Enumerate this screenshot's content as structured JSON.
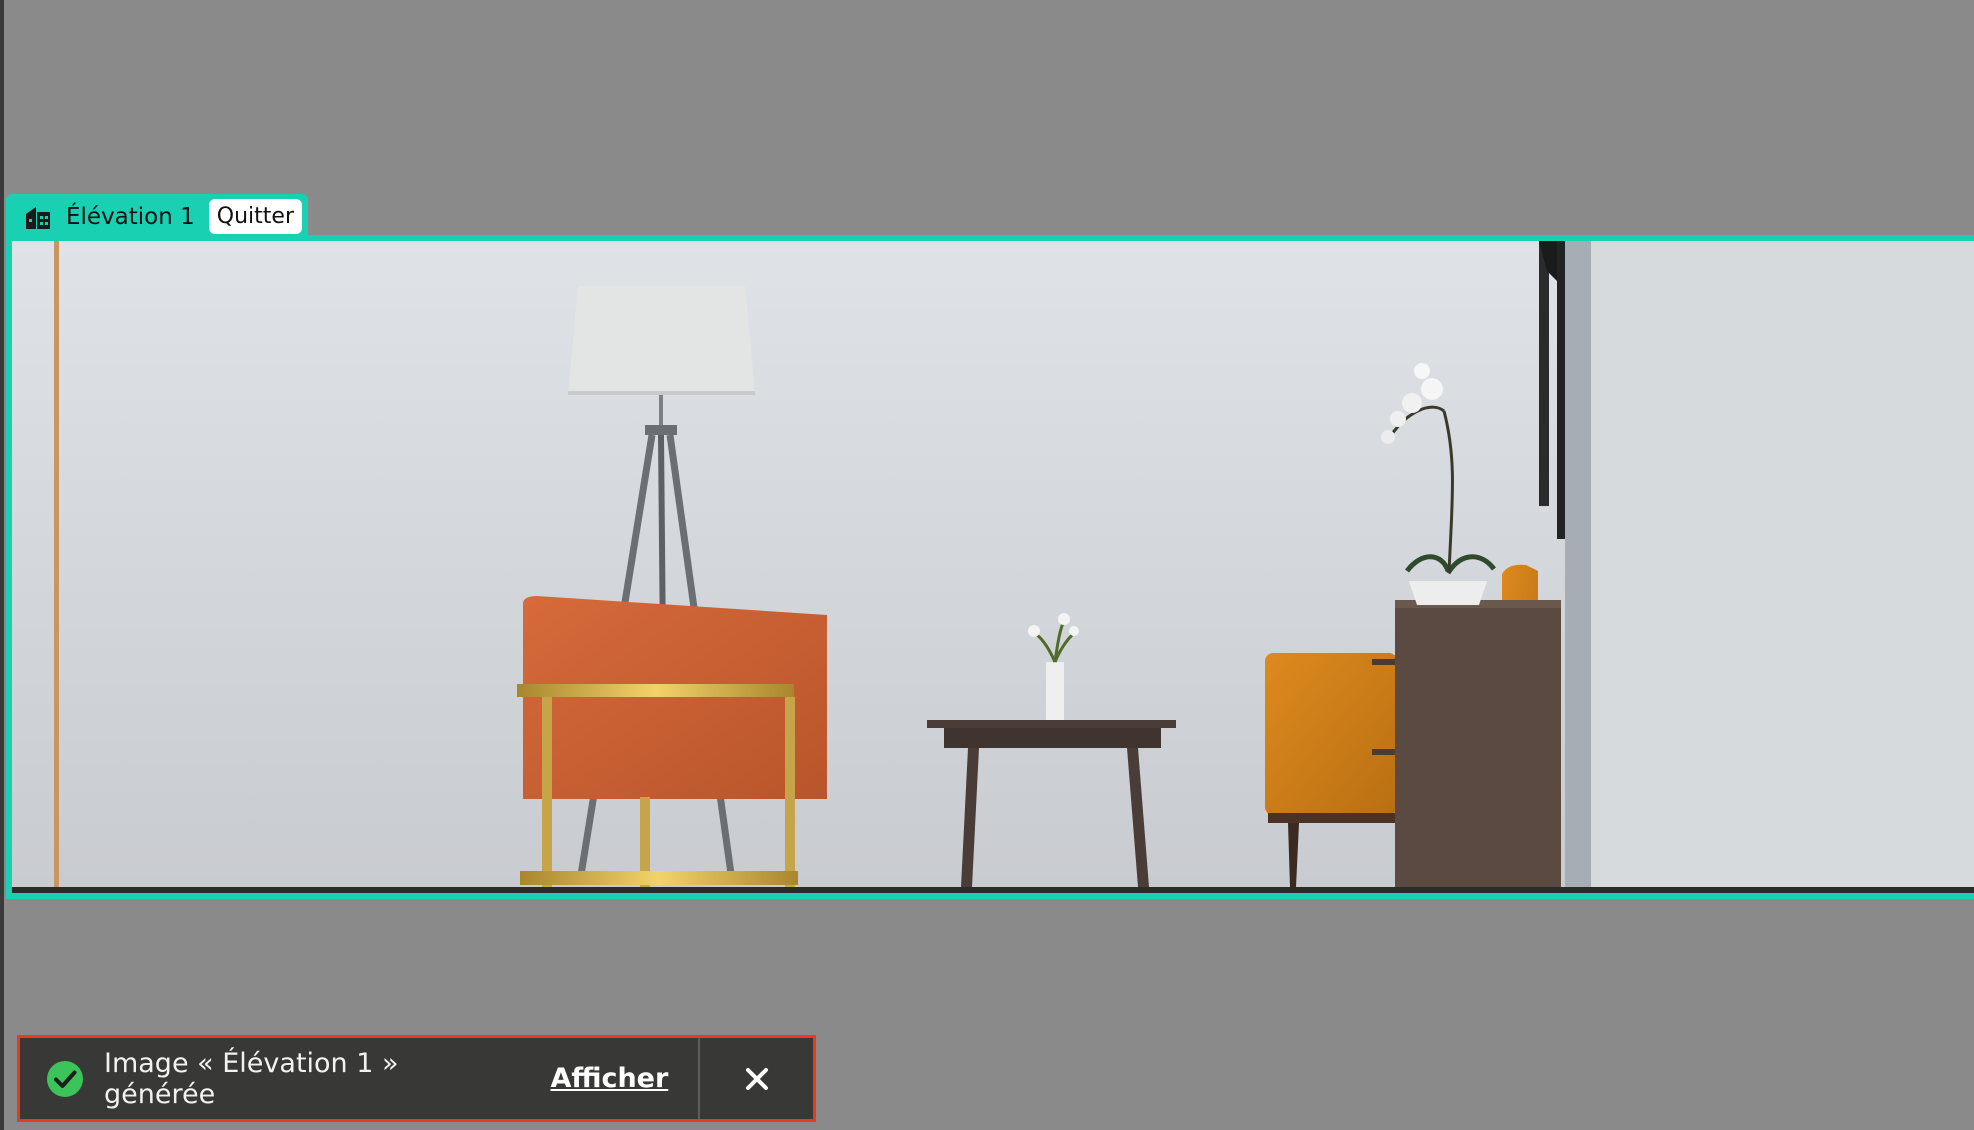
{
  "elevation": {
    "title": "Élévation 1",
    "quit_label": "Quitter",
    "icon": "building-icon"
  },
  "toast": {
    "message": "Image « Élévation 1 » générée",
    "action_label": "Afficher",
    "status_icon": "check-circle-icon",
    "close_icon": "close-icon"
  },
  "colors": {
    "accent": "#19d0b3",
    "toast_bg": "#383836",
    "toast_border": "#e83a1c",
    "success": "#3cc45a"
  }
}
